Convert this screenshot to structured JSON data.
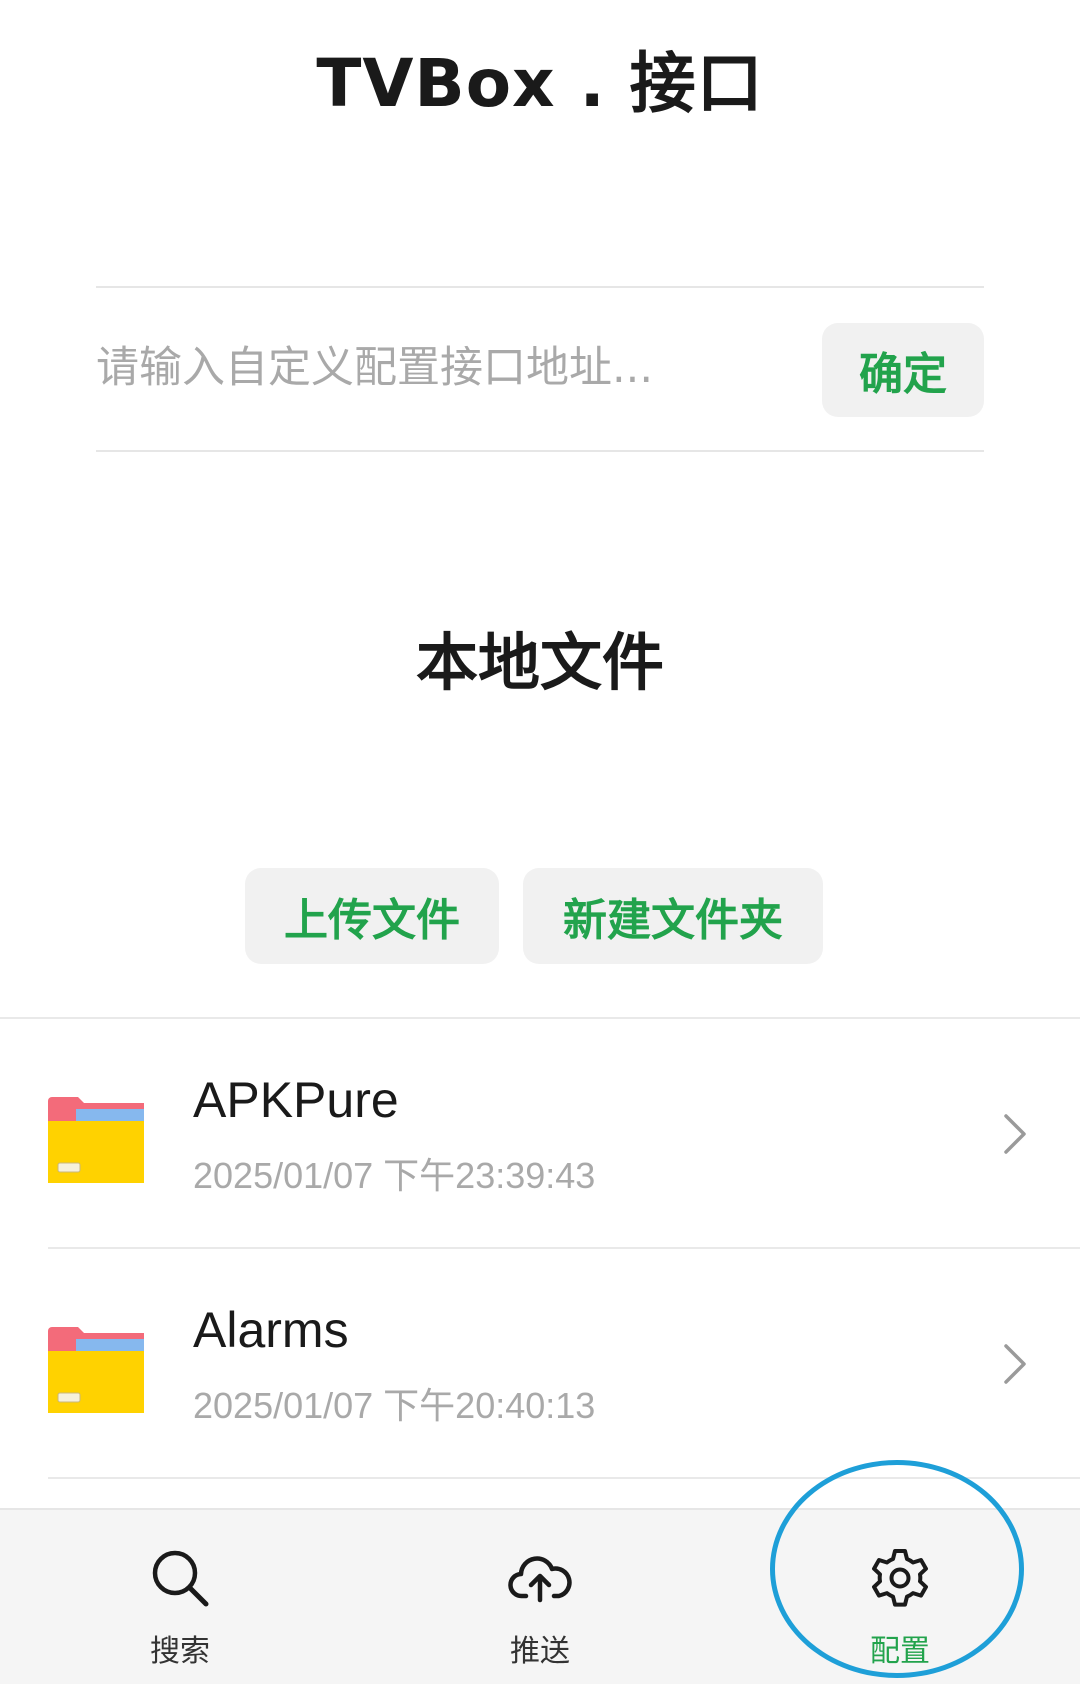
{
  "header": {
    "title": "TVBox . 接口"
  },
  "config": {
    "input_value": "",
    "input_placeholder": "请输入自定义配置接口地址...",
    "confirm_label": "确定"
  },
  "local_files": {
    "title": "本地文件",
    "upload_label": "上传文件",
    "new_folder_label": "新建文件夹",
    "items": [
      {
        "name": "APKPure",
        "date": "2025/01/07 下午23:39:43",
        "icon": "folder-icon"
      },
      {
        "name": "Alarms",
        "date": "2025/01/07 下午20:40:13",
        "icon": "folder-icon"
      }
    ]
  },
  "bottom_nav": {
    "items": [
      {
        "label": "搜索",
        "icon": "search-icon",
        "active": false
      },
      {
        "label": "推送",
        "icon": "cloud-upload-icon",
        "active": false
      },
      {
        "label": "配置",
        "icon": "gear-icon",
        "active": true
      }
    ]
  },
  "colors": {
    "accent_green": "#22a34c",
    "highlight_blue": "#1e9fd8",
    "folder_yellow": "#ffd200",
    "folder_red": "#f36b7a",
    "folder_blue": "#86b8ee"
  }
}
